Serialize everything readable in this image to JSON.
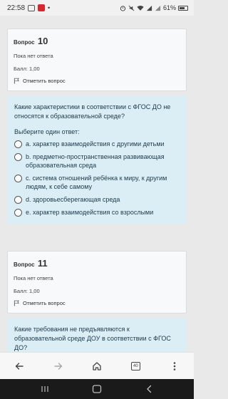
{
  "status_bar": {
    "time": "22:58",
    "battery_text": "61%"
  },
  "question10": {
    "label": "Вопрос",
    "number": "10",
    "state": "Пока нет ответа",
    "grade": "Балл: 1,00",
    "flag": "Отметить вопрос",
    "text": "Какие характеристики в соответствии с ФГОС ДО не относятся к образовательной среде?",
    "prompt": "Выберите один ответ:",
    "options": [
      "a. характер взаимодействия с другими детьми",
      "b. предметно-пространственная развивающая образовательная среда",
      "c. система отношений ребёнка к миру, к другим людям, к себе самому",
      "d. здоровьесберегающая среда",
      "e. характер взаимодействия со взрослыми"
    ]
  },
  "question11": {
    "label": "Вопрос",
    "number": "11",
    "state": "Пока нет ответа",
    "grade": "Балл: 1,00",
    "flag": "Отметить вопрос",
    "text": "Какие требования не предъявляются к образовательной среде ДОУ в соответствии с ФГОС ДО?"
  },
  "browser_nav": {
    "icons": [
      "back-arrow-icon",
      "forward-arrow-icon",
      "home-icon",
      "tabs-icon",
      "menu-dots-icon"
    ],
    "tab_count": "40"
  },
  "system_nav": {
    "icons": [
      "recent-apps-icon",
      "home-pill-icon",
      "back-chevron-icon"
    ]
  }
}
